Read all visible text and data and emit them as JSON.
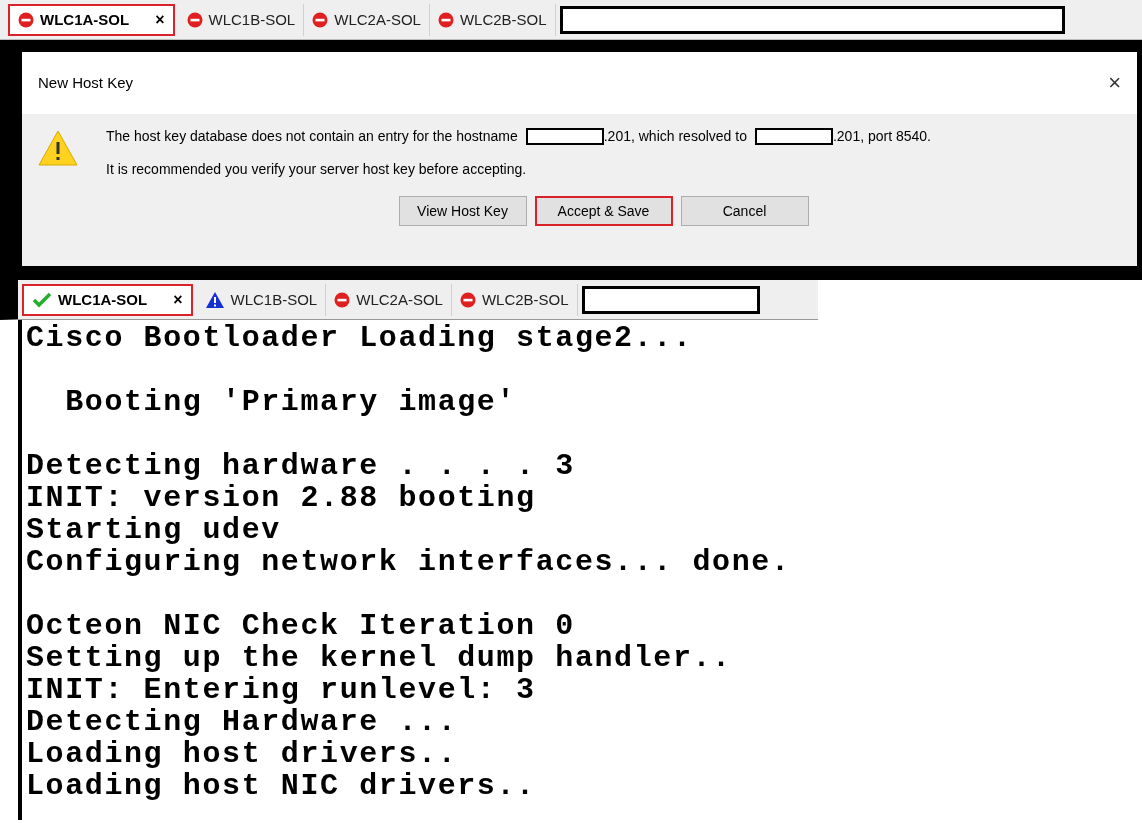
{
  "top_tabs": [
    {
      "label": "WLC1A-SOL",
      "kind": "stop",
      "selected": true,
      "close": "×"
    },
    {
      "label": "WLC1B-SOL",
      "kind": "stop",
      "selected": false
    },
    {
      "label": "WLC2A-SOL",
      "kind": "stop",
      "selected": false
    },
    {
      "label": "WLC2B-SOL",
      "kind": "stop",
      "selected": false
    }
  ],
  "dialog": {
    "title": "New Host Key",
    "close": "×",
    "message": [
      {
        "kind": "text",
        "text": "The host key database does not contain an entry for the hostname"
      },
      {
        "kind": "redacted"
      },
      {
        "kind": "text",
        "text": ".201, which resolved to"
      },
      {
        "kind": "redacted"
      },
      {
        "kind": "text",
        "text": ".201, port 8540."
      }
    ],
    "note": "It is recommended you verify your server host key before accepting.",
    "buttons": [
      {
        "label": "View Host Key",
        "selected": false
      },
      {
        "label": "Accept & Save",
        "selected": true
      },
      {
        "label": "Cancel",
        "selected": false
      }
    ]
  },
  "bottom_tabs": [
    {
      "label": "WLC1A-SOL",
      "kind": "check",
      "selected": true,
      "close": "×"
    },
    {
      "label": "WLC1B-SOL",
      "kind": "warning",
      "selected": false
    },
    {
      "label": "WLC2A-SOL",
      "kind": "stop",
      "selected": false
    },
    {
      "label": "WLC2B-SOL",
      "kind": "stop",
      "selected": false
    }
  ],
  "terminal": [
    [
      "Cisco Bootloader Loading stage2..."
    ],
    [
      "  Booting 'Primary image'"
    ],
    [
      "Detecting hardware . . . . 3",
      "INIT: version 2.88 booting",
      "Starting udev",
      "Configuring network interfaces... done."
    ],
    [
      "Octeon NIC Check Iteration 0",
      "Setting up the kernel dump handler..",
      "INIT: Entering runlevel: 3",
      "Detecting Hardware ...",
      "Loading host drivers..",
      "Loading host NIC drivers.."
    ]
  ]
}
